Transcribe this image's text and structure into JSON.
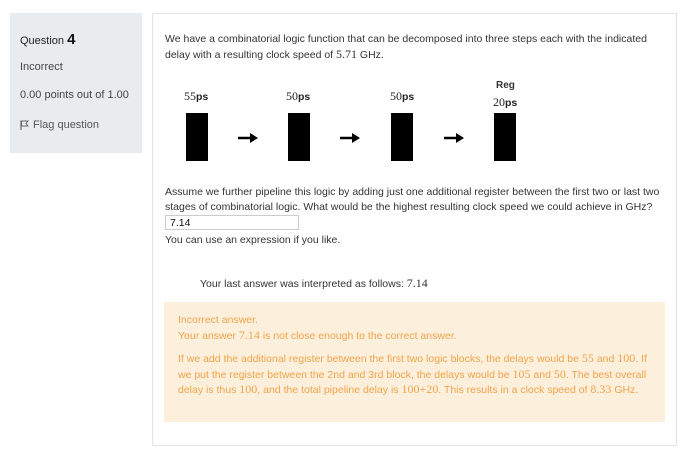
{
  "info": {
    "question_label": "Question",
    "question_number": "4",
    "status": "Incorrect",
    "points": "0.00 points out of 1.00",
    "flag_label": "Flag question"
  },
  "question": {
    "intro_part1": "We have a combinatorial logic function that can be decomposed into three steps each with the indicated delay with a resulting clock speed of ",
    "intro_value": "5.71",
    "intro_unit": " GHz.",
    "stages": [
      {
        "num": "55",
        "unit": "ps"
      },
      {
        "num": "50",
        "unit": "ps"
      },
      {
        "num": "50",
        "unit": "ps"
      },
      {
        "num": "20",
        "unit": "ps"
      }
    ],
    "reg_label": "Reg",
    "prompt": "Assume we further pipeline this logic by adding just one additional register between the first two or last two stages of combinatorial logic. What would be the highest resulting clock speed we could achieve in GHz?",
    "answer_value": "7.14",
    "expression_hint": "You can use an expression if you like."
  },
  "interpretation": {
    "text": "Your last answer was interpreted as follows: ",
    "value": "7.14"
  },
  "feedback": {
    "line1": "Incorrect answer.",
    "line2_a": "Your answer ",
    "line2_value": "7.14",
    "line2_b": " is not close enough to the correct answer.",
    "p_a": "If we add the additional register between the first two logic blocks, the delays would be ",
    "p_v1": "55",
    "p_b": " and ",
    "p_v2": "100",
    "p_c": ". If we put the register between the 2nd and 3rd block, the delays would be ",
    "p_v3": "105",
    "p_d": " and ",
    "p_v4": "50",
    "p_e": ". The best overall delay is thus ",
    "p_v5": "100",
    "p_f": ", and the total pipeline delay is ",
    "p_v6": "100+20",
    "p_g": ". This results in a clock speed of ",
    "p_v7": "8.33",
    "p_h": " GHz."
  },
  "colors": {
    "info_bg": "#e9ecef",
    "feedback_bg": "#fcefdc",
    "feedback_text": "#f0a44a"
  }
}
